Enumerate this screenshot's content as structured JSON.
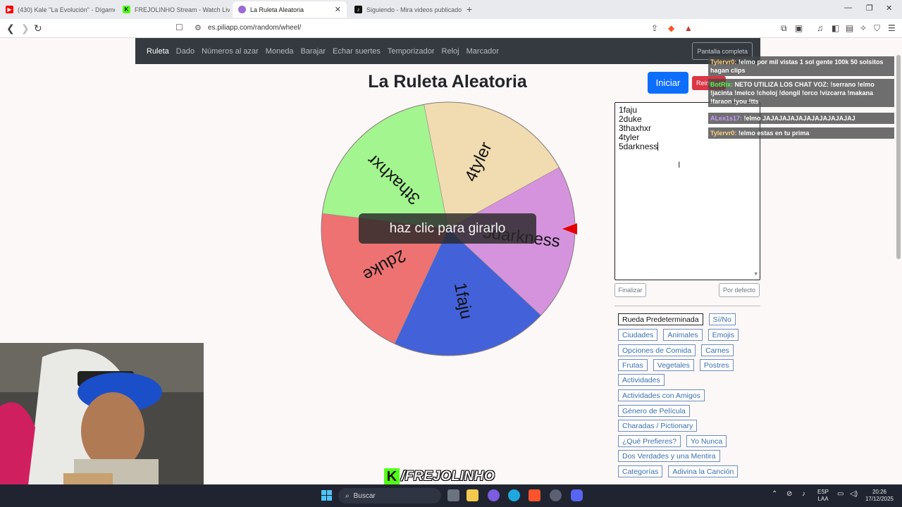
{
  "browser": {
    "tabs": [
      {
        "label": "(430) Kale \"La Evolución\" - Dígame U",
        "color": "#ff0000",
        "glyph": "▶"
      },
      {
        "label": "FREJOLINHO Stream - Watch Live on",
        "color": "#53fc18",
        "glyph": "K"
      },
      {
        "label": "La Ruleta Aleatoria",
        "color": "#9c6bd6",
        "glyph": "●"
      },
      {
        "label": "Siguiendo - Mira videos publicados p",
        "color": "#111111",
        "glyph": "♪"
      }
    ],
    "url": "es.piliapp.com/random/wheel/"
  },
  "nav": {
    "links": [
      "Ruleta",
      "Dado",
      "Números al azar",
      "Moneda",
      "Barajar",
      "Echar suertes",
      "Temporizador",
      "Reloj",
      "Marcador"
    ],
    "fullscreen": "Pantalla completa"
  },
  "main": {
    "title": "La Ruleta Aleatoria",
    "start_label": "Iniciar",
    "reset_label": "Reini",
    "overlay": "haz clic para girarlo"
  },
  "wheel": {
    "segments": [
      {
        "label": "1faju",
        "color": "#4361d8"
      },
      {
        "label": "2duke",
        "color": "#ee7272"
      },
      {
        "label": "3thaxhxr",
        "color": "#a3f58f"
      },
      {
        "label": "4tyler",
        "color": "#f1dcb1"
      },
      {
        "label": "5darkness",
        "color": "#d593de"
      }
    ],
    "pointer_color": "#e40000"
  },
  "editor": {
    "lines": [
      "1faju",
      "2duke",
      "3thaxhxr",
      "4tyler",
      "5darkness"
    ],
    "finish_label": "Finalizar",
    "default_label": "Por defecto"
  },
  "presets": {
    "rows": [
      [
        "Rueda Predeterminada",
        "Sí/No"
      ],
      [
        "Ciudades",
        "Animales",
        "Emojis"
      ],
      [
        "Opciones de Comida",
        "Carnes"
      ],
      [
        "Frutas",
        "Vegetales",
        "Postres"
      ],
      [
        "Actividades"
      ],
      [
        "Actividades con Amigos"
      ],
      [
        "Género de Película"
      ],
      [
        "Charadas / Pictionary"
      ],
      [
        "¿Qué Prefieres?",
        "Yo Nunca"
      ],
      [
        "Dos Verdades y una Mentira"
      ],
      [
        "Categorías",
        "Adivina la Canción"
      ]
    ]
  },
  "chat": [
    {
      "user": "Tylervr0:",
      "text": " !elmo por mil vistas 1 sol gente 100k 50 solsitos hagan clips",
      "cls": "u1"
    },
    {
      "user": "BotRix:",
      "text": " NETO UTILIZA LOS CHAT VOZ: !serrano !elmo !jacinta !melco !choloj !dongil !orco !vizcarra !makana !faraon !you !tts",
      "cls": "u2"
    },
    {
      "user": "ALex1s17:",
      "text": " !elmo JAJAJAJAJAJAJAJAJAJAJAJ",
      "cls": "u3"
    },
    {
      "user": "Tylervr0:",
      "text": " !elmo estas en tu prima",
      "cls": "u1"
    }
  ],
  "stream": {
    "brand": "/FREJOLINHO"
  },
  "taskbar": {
    "search": "Buscar",
    "lang": "ESP",
    "lang2": "LAA",
    "time": "20:26",
    "date": "17/12/2025"
  }
}
